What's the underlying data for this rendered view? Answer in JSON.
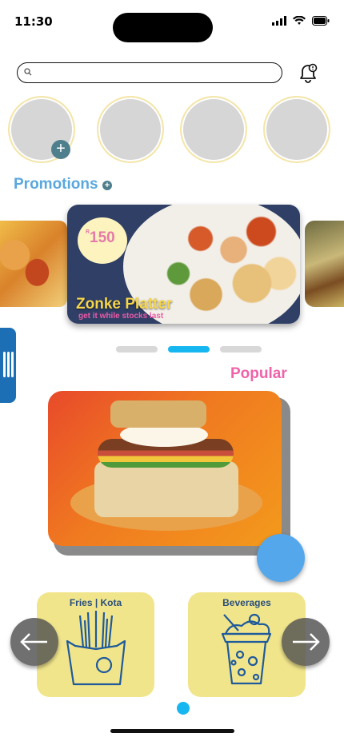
{
  "status_bar": {
    "time": "11:30"
  },
  "search": {
    "placeholder": ""
  },
  "icons": {
    "search": "search-icon",
    "bell": "bell-icon",
    "add": "plus-icon",
    "left_arrow": "arrow-left-icon",
    "right_arrow": "arrow-right-icon",
    "fries": "fries-icon",
    "drink": "milkshake-icon"
  },
  "stories": {
    "add_symbol": "+"
  },
  "promotions": {
    "title": "Promotions",
    "featured": {
      "currency": "R",
      "price": "150",
      "name": "Zonke Platter",
      "tagline": "get it while stocks last"
    },
    "carousel_count": 3,
    "active_index": 1
  },
  "popular": {
    "title": "Popular"
  },
  "categories": [
    {
      "label": "Fries | Kota"
    },
    {
      "label": "Beverages"
    }
  ],
  "colors": {
    "accent_blue": "#5aa7de",
    "accent_pink": "#ef63a8",
    "accent_yellow": "#f6d54a",
    "card_yellow": "#f1e58c",
    "active_dot": "#16b6f0"
  }
}
